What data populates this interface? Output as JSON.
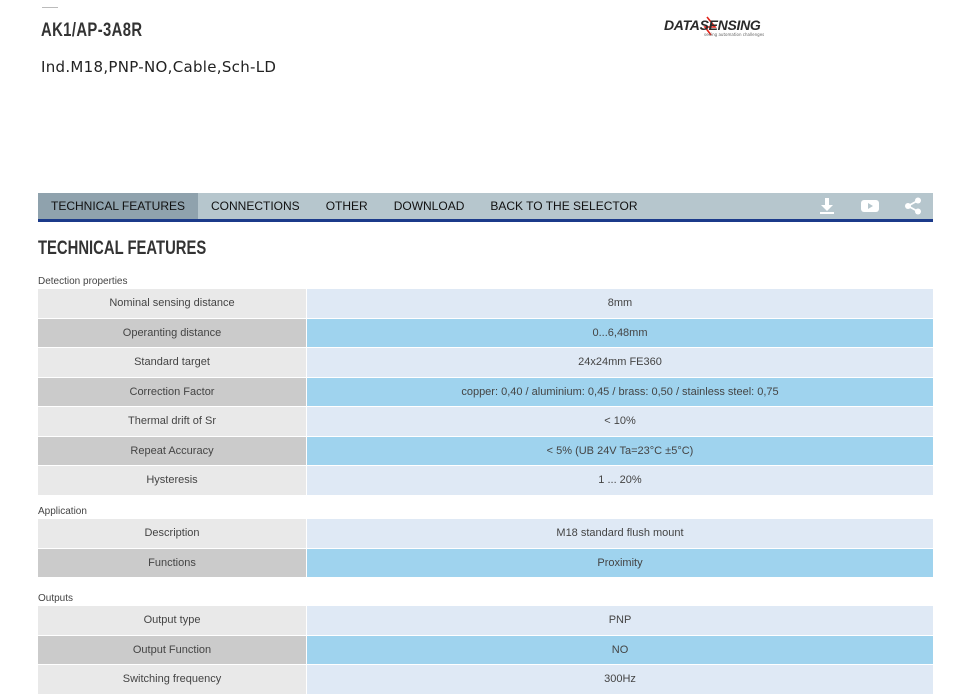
{
  "product": {
    "code": "AK1/AP-3A8R",
    "description": "Ind.M18,PNP-NO,Cable,Sch-LD"
  },
  "logo": {
    "text": "DATASENSING",
    "tagline": "seeing automation challenges"
  },
  "tabs": [
    {
      "label": "TECHNICAL FEATURES",
      "active": true
    },
    {
      "label": "CONNECTIONS",
      "active": false
    },
    {
      "label": "OTHER",
      "active": false
    },
    {
      "label": "DOWNLOAD",
      "active": false
    },
    {
      "label": "BACK TO THE SELECTOR",
      "active": false
    }
  ],
  "tab_icons": [
    "download-icon",
    "video-icon",
    "share-icon"
  ],
  "section_title": "TECHNICAL FEATURES",
  "groups": [
    {
      "title": "Detection properties",
      "rows": [
        {
          "label": "Nominal sensing distance",
          "value": "8mm"
        },
        {
          "label": "Operanting distance",
          "value": "0...6,48mm"
        },
        {
          "label": "Standard target",
          "value": "24x24mm FE360"
        },
        {
          "label": "Correction Factor",
          "value": "copper: 0,40 / aluminium: 0,45 / brass: 0,50 / stainless steel: 0,75"
        },
        {
          "label": "Thermal drift of Sr",
          "value": "< 10%"
        },
        {
          "label": "Repeat Accuracy",
          "value": "< 5% (UB 24V Ta=23°C ±5°C)"
        },
        {
          "label": "Hysteresis",
          "value": "1 ... 20%"
        }
      ]
    },
    {
      "title": "Application",
      "rows": [
        {
          "label": "Description",
          "value": "M18 standard flush mount"
        },
        {
          "label": "Functions",
          "value": "Proximity"
        }
      ]
    },
    {
      "title": "Outputs",
      "rows": [
        {
          "label": "Output type",
          "value": "PNP"
        },
        {
          "label": "Output Function",
          "value": "NO"
        },
        {
          "label": "Switching frequency",
          "value": "300Hz"
        }
      ]
    }
  ],
  "colors": {
    "tabbar_bg": "#b6c6cd",
    "tab_active_bg": "#8fa2ad",
    "tabbar_underline": "#1b3a8a",
    "row_value_light": "#dfe9f5",
    "row_value_dark": "#9fd3ee"
  }
}
